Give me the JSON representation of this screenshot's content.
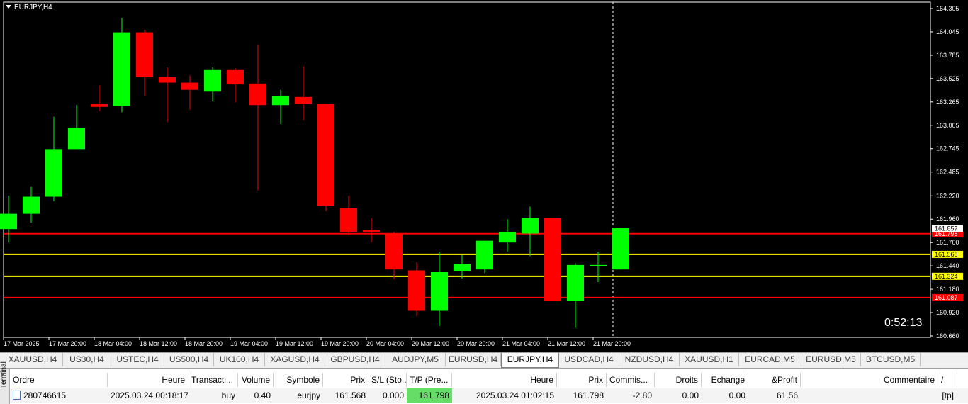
{
  "chart": {
    "symbol": "EURJPY,H4",
    "timer": "0:52:13",
    "colors": {
      "bull": "#00ff00",
      "bear": "#ff0000",
      "background": "#000000",
      "axis": "#ffffff",
      "tp_line": "#ff0000",
      "entry_line": "#ffff00"
    }
  },
  "chart_data": {
    "type": "candlestick",
    "price_ticks": [
      "164.305",
      "164.045",
      "163.785",
      "163.525",
      "163.265",
      "163.005",
      "162.745",
      "162.485",
      "162.220",
      "161.960",
      "161.700",
      "161.440",
      "161.180",
      "160.920",
      "160.660"
    ],
    "time_ticks": [
      "17 Mar 2025",
      "17 Mar 20:00",
      "18 Mar 04:00",
      "18 Mar 12:00",
      "18 Mar 20:00",
      "19 Mar 04:00",
      "19 Mar 12:00",
      "19 Mar 20:00",
      "20 Mar 04:00",
      "20 Mar 12:00",
      "20 Mar 20:00",
      "21 Mar 04:00",
      "21 Mar 12:00",
      "21 Mar 20:00"
    ],
    "ylim": [
      160.62,
      164.34
    ],
    "candles": [
      {
        "o": 161.85,
        "h": 162.22,
        "l": 161.7,
        "c": 162.02
      },
      {
        "o": 162.02,
        "h": 162.32,
        "l": 161.92,
        "c": 162.21
      },
      {
        "o": 162.21,
        "h": 163.1,
        "l": 162.16,
        "c": 162.74
      },
      {
        "o": 162.74,
        "h": 163.23,
        "l": 162.82,
        "c": 162.98
      },
      {
        "o": 163.24,
        "h": 163.45,
        "l": 163.16,
        "c": 163.21
      },
      {
        "o": 163.22,
        "h": 164.2,
        "l": 163.15,
        "c": 164.04
      },
      {
        "o": 164.04,
        "h": 164.07,
        "l": 163.33,
        "c": 163.54
      },
      {
        "o": 163.54,
        "h": 163.65,
        "l": 163.04,
        "c": 163.48
      },
      {
        "o": 163.48,
        "h": 163.56,
        "l": 163.18,
        "c": 163.4
      },
      {
        "o": 163.38,
        "h": 163.65,
        "l": 163.27,
        "c": 163.62
      },
      {
        "o": 163.62,
        "h": 163.64,
        "l": 163.26,
        "c": 163.46
      },
      {
        "o": 163.47,
        "h": 163.9,
        "l": 162.28,
        "c": 163.23
      },
      {
        "o": 163.23,
        "h": 163.4,
        "l": 163.02,
        "c": 163.33
      },
      {
        "o": 163.32,
        "h": 163.66,
        "l": 163.06,
        "c": 163.24
      },
      {
        "o": 163.24,
        "h": 163.24,
        "l": 162.05,
        "c": 162.11
      },
      {
        "o": 162.08,
        "h": 162.22,
        "l": 161.78,
        "c": 161.82
      },
      {
        "o": 161.84,
        "h": 161.97,
        "l": 161.7,
        "c": 161.82
      },
      {
        "o": 161.8,
        "h": 161.82,
        "l": 161.29,
        "c": 161.4
      },
      {
        "o": 161.39,
        "h": 161.48,
        "l": 160.88,
        "c": 160.94
      },
      {
        "o": 160.94,
        "h": 161.6,
        "l": 160.77,
        "c": 161.37
      },
      {
        "o": 161.38,
        "h": 161.56,
        "l": 161.3,
        "c": 161.46
      },
      {
        "o": 161.4,
        "h": 161.72,
        "l": 161.36,
        "c": 161.72
      },
      {
        "o": 161.7,
        "h": 161.96,
        "l": 161.6,
        "c": 161.82
      },
      {
        "o": 161.8,
        "h": 162.1,
        "l": 161.55,
        "c": 161.97
      },
      {
        "o": 161.97,
        "h": 161.97,
        "l": 161.05,
        "c": 161.05
      },
      {
        "o": 161.05,
        "h": 161.47,
        "l": 160.75,
        "c": 161.45
      },
      {
        "o": 161.45,
        "h": 161.6,
        "l": 161.26,
        "c": 161.45
      },
      {
        "o": 161.4,
        "h": 161.86,
        "l": 161.4,
        "c": 161.86
      }
    ],
    "bid_line": 161.857,
    "bid_label": "161.857",
    "horizontal_lines": [
      {
        "price": 161.798,
        "label": "161.798",
        "color": "#ff0000"
      },
      {
        "price": 161.568,
        "label": "161.568",
        "color": "#ffff00"
      },
      {
        "price": 161.324,
        "label": "161.324",
        "color": "#ffff00"
      },
      {
        "price": 161.087,
        "label": "161.087",
        "color": "#ff0000"
      }
    ],
    "vertical_marker_index": 27,
    "grid": false
  },
  "tabs": [
    {
      "label": "XAUUSD,H4",
      "active": false
    },
    {
      "label": "US30,H4",
      "active": false
    },
    {
      "label": "USTEC,H4",
      "active": false
    },
    {
      "label": "US500,H4",
      "active": false
    },
    {
      "label": "UK100,H4",
      "active": false
    },
    {
      "label": "XAGUSD,H4",
      "active": false
    },
    {
      "label": "GBPUSD,H4",
      "active": false
    },
    {
      "label": "AUDJPY,M5",
      "active": false
    },
    {
      "label": "EURUSD,H4",
      "active": false
    },
    {
      "label": "EURJPY,H4",
      "active": true
    },
    {
      "label": "USDCAD,H4",
      "active": false
    },
    {
      "label": "NZDUSD,H4",
      "active": false
    },
    {
      "label": "XAUUSD,H1",
      "active": false
    },
    {
      "label": "EURCAD,M5",
      "active": false
    },
    {
      "label": "EURUSD,M5",
      "active": false
    },
    {
      "label": "BTCUSD,M5",
      "active": false
    }
  ],
  "terminal": {
    "side_label": "Terminal",
    "close": "×",
    "headers": [
      "Ordre",
      "Heure",
      "Transacti...",
      "Volume",
      "Symbole",
      "Prix",
      "S/L (Sto...",
      "T/P (Pre...",
      "Heure",
      "Prix",
      "Commis...",
      "Droits",
      "Echange",
      "&Profit",
      "Commentaire",
      "/"
    ],
    "row": {
      "ordre": "280746615",
      "heure": "2025.03.24 00:18:17",
      "transaction": "buy",
      "volume": "0.40",
      "symbole": "eurjpy",
      "prix": "161.568",
      "sl": "0.000",
      "tp": "161.798",
      "heure2": "2025.03.24 01:02:15",
      "prix2": "161.798",
      "commission": "-2.80",
      "droits": "0.00",
      "echange": "0.00",
      "profit": "61.56",
      "commentaire": "[tp]"
    }
  }
}
